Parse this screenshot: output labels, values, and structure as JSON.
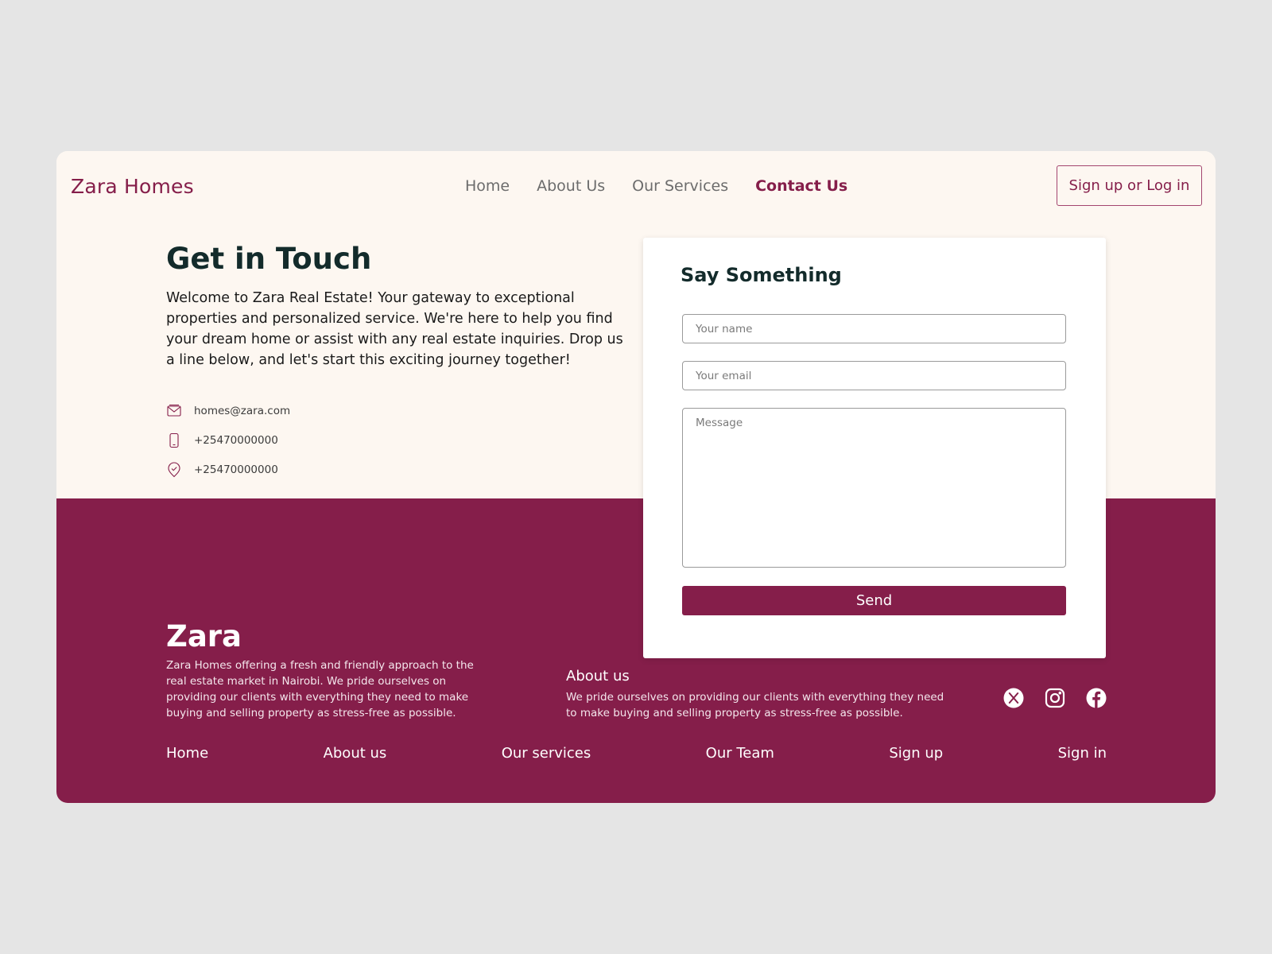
{
  "brand": {
    "logo": "Zara Homes"
  },
  "nav": {
    "items": [
      {
        "label": "Home"
      },
      {
        "label": "About Us"
      },
      {
        "label": "Our Services"
      },
      {
        "label": "Contact Us"
      }
    ],
    "active": "Contact Us",
    "auth_label": "Sign up or Log in"
  },
  "hero": {
    "title": "Get in Touch",
    "text": "Welcome to Zara Real Estate! Your gateway to exceptional properties and personalized service. We're here to help you find your dream home or assist with any real estate inquiries. Drop us a line below, and let's start this exciting journey together!",
    "contacts": [
      {
        "icon": "mail-icon",
        "text": "homes@zara.com"
      },
      {
        "icon": "phone-icon",
        "text": "+25470000000"
      },
      {
        "icon": "location-icon",
        "text": "+25470000000"
      }
    ]
  },
  "form": {
    "title": "Say Something",
    "name_placeholder": "Your name",
    "email_placeholder": "Your email",
    "message_placeholder": "Message",
    "send_label": "Send"
  },
  "footer": {
    "brand": "Zara",
    "brand_text": "Zara Homes offering a fresh and friendly approach to the real estate market in Nairobi. We pride ourselves on providing our clients with everything they need to make buying and selling property as stress-free as possible.",
    "about_title": "About us",
    "about_text": "We pride ourselves on providing our clients with everything they need to make buying and selling property as stress-free as possible.",
    "socials": [
      "x-icon",
      "instagram-icon",
      "facebook-icon"
    ],
    "links": [
      {
        "label": "Home"
      },
      {
        "label": "About us"
      },
      {
        "label": "Our services"
      },
      {
        "label": "Our Team"
      },
      {
        "label": "Sign up"
      },
      {
        "label": "Sign in"
      }
    ]
  },
  "colors": {
    "accent": "#851e4a",
    "cream": "#fdf7f1",
    "heading": "#132b2b",
    "page_bg": "#e5e5e5"
  }
}
